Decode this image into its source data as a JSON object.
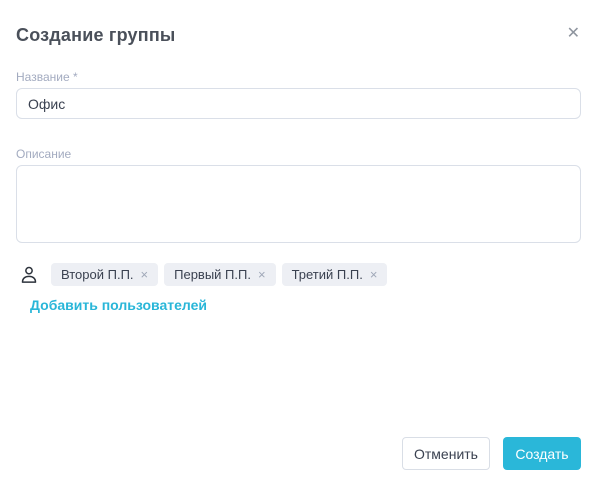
{
  "dialog": {
    "title": "Создание группы"
  },
  "icons": {
    "close": "✕",
    "chip_remove": "×",
    "members": "person-outline-icon"
  },
  "form": {
    "name_field": {
      "label": "Название",
      "required_mark": "*",
      "value": "Офис"
    },
    "description_field": {
      "label": "Описание",
      "value": ""
    }
  },
  "members": {
    "chips": [
      {
        "label": "Второй П.П."
      },
      {
        "label": "Первый П.П."
      },
      {
        "label": "Третий П.П."
      }
    ],
    "add_link_label": "Добавить пользователей"
  },
  "footer": {
    "cancel_label": "Отменить",
    "create_label": "Создать"
  },
  "colors": {
    "accent": "#2ab7d9",
    "link": "#29b6d8",
    "label": "#a3abc0",
    "text": "#3a4150",
    "border": "#dadfe8",
    "chip_bg": "#edeff4",
    "muted_icon": "#8f959f"
  }
}
